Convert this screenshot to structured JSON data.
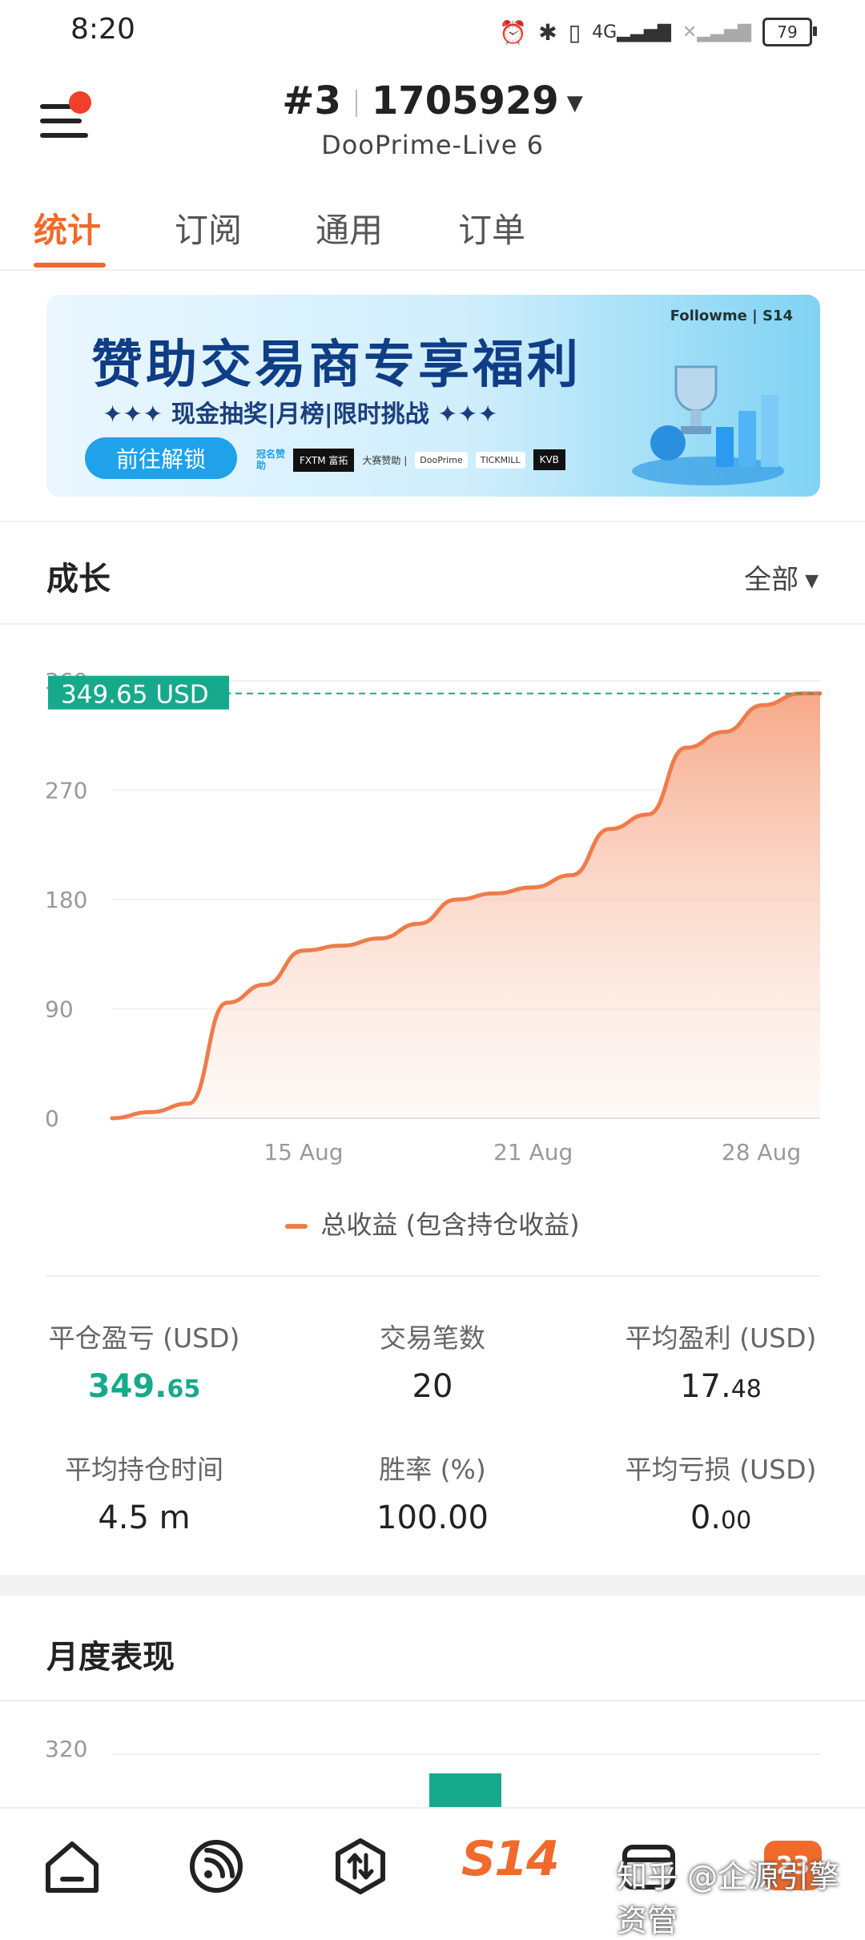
{
  "status": {
    "time": "8:20",
    "battery": "79",
    "icons": [
      "alarm-icon",
      "bluetooth-icon",
      "vibrate-icon",
      "signal-4g-icon",
      "signal-no-sim-icon"
    ]
  },
  "header": {
    "account_no": "#3",
    "account_id": "1705929",
    "server": "DooPrime-Live 6"
  },
  "tabs": [
    {
      "label": "统计",
      "active": true
    },
    {
      "label": "订阅",
      "active": false
    },
    {
      "label": "通用",
      "active": false
    },
    {
      "label": "订单",
      "active": false
    }
  ],
  "banner": {
    "brand": "Followme | S14",
    "title": "赞助交易商专享福利",
    "subtitle": "✦✦✦ 现金抽奖|月榜|限时挑战 ✦✦✦",
    "button": "前往解锁",
    "sponsor_label": "冠名赞助",
    "sponsor_main": "FXTM 富拓",
    "sponsor_label2": "大赛赞助 |",
    "sponsors": [
      "DooPrime",
      "TICKMILL",
      "KVB"
    ]
  },
  "growth": {
    "title": "成长",
    "filter": "全部"
  },
  "chart_data": {
    "type": "area",
    "title": "",
    "current_label": "349.65 USD",
    "y_ticks": [
      "0",
      "90",
      "180",
      "270",
      "360"
    ],
    "ylim": [
      0,
      360
    ],
    "x_ticks": [
      "15 Aug",
      "21 Aug",
      "28 Aug"
    ],
    "x_tick_positions": [
      10,
      16,
      23
    ],
    "xlim": [
      5,
      23.5
    ],
    "series": [
      {
        "name": "总收益 (包含持仓收益)",
        "color": "#ee7c4b",
        "x": [
          5,
          6,
          7,
          8,
          9,
          10,
          11,
          12,
          13,
          14,
          15,
          16,
          17,
          18,
          19,
          20,
          21,
          22,
          23,
          23.5
        ],
        "y": [
          0,
          5,
          12,
          95,
          110,
          138,
          142,
          148,
          160,
          180,
          185,
          190,
          200,
          238,
          250,
          305,
          318,
          340,
          349.65,
          349.65
        ]
      }
    ],
    "reference_line": 349.65,
    "grid": true
  },
  "stats": [
    {
      "label": "平仓盈亏 (USD)",
      "value_main": "349.",
      "value_small": "65",
      "green": true
    },
    {
      "label": "交易笔数",
      "value_main": "20",
      "value_small": "",
      "green": false
    },
    {
      "label": "平均盈利 (USD)",
      "value_main": "17.",
      "value_small": "48",
      "green": false
    },
    {
      "label": "平均持仓时间",
      "value_main": "4.5 m",
      "value_small": "",
      "green": false
    },
    {
      "label": "胜率 (%)",
      "value_main": "100.00",
      "value_small": "",
      "green": false
    },
    {
      "label": "平均亏损 (USD)",
      "value_main": "0.",
      "value_small": "00",
      "green": false
    }
  ],
  "monthly": {
    "title": "月度表现",
    "y_tick": "320"
  },
  "nav": {
    "items": [
      "home-icon",
      "feed-icon",
      "trade-icon",
      "s14-icon",
      "wallet-icon",
      "profile-icon"
    ],
    "s14_label": "S14",
    "badge": "23",
    "watermark": "知乎 @企源引擎资管"
  }
}
